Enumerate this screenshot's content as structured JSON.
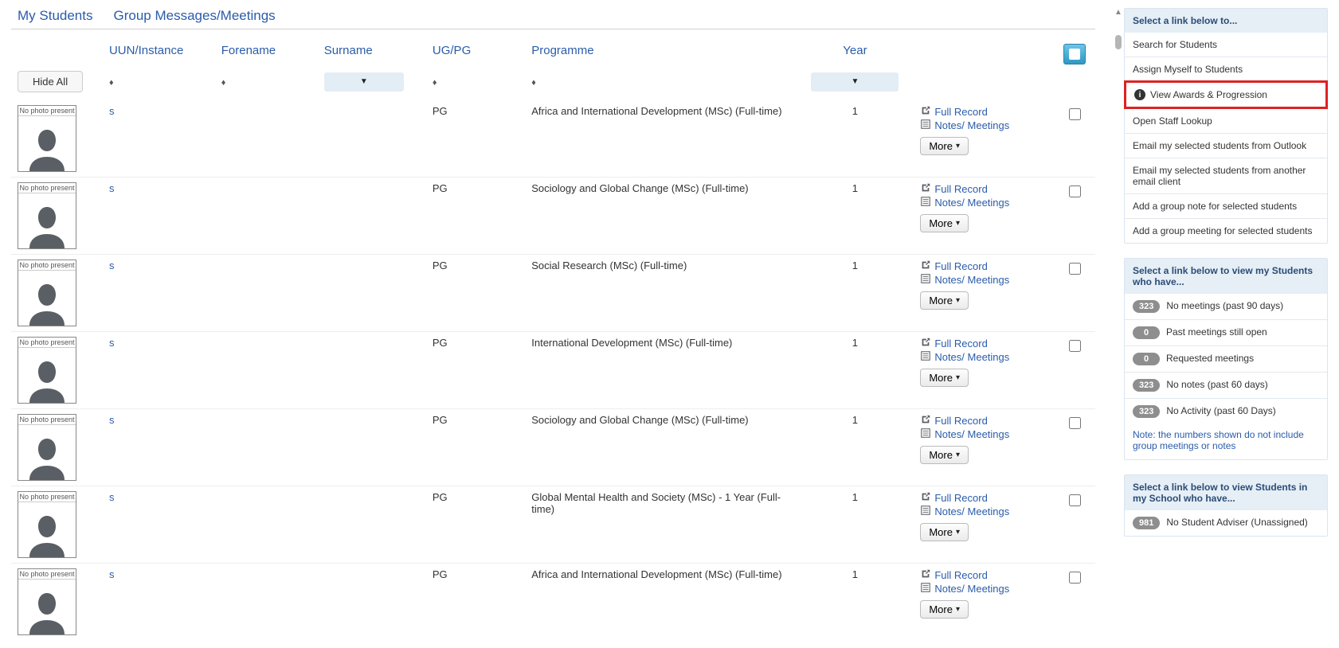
{
  "tabs": {
    "my_students": "My Students",
    "group_msgs": "Group Messages/Meetings"
  },
  "headers": {
    "uun": "UUN/Instance",
    "forename": "Forename",
    "surname": "Surname",
    "ugpg": "UG/PG",
    "programme": "Programme",
    "year": "Year"
  },
  "hide_all": "Hide All",
  "no_photo": "No photo present",
  "links": {
    "full_record": "Full Record",
    "notes": "Notes/ Meetings",
    "more": "More"
  },
  "rows": [
    {
      "uun": "s",
      "ugpg": "PG",
      "programme": "Africa and International Development (MSc) (Full-time)",
      "year": "1"
    },
    {
      "uun": "s",
      "ugpg": "PG",
      "programme": "Sociology and Global Change (MSc) (Full-time)",
      "year": "1"
    },
    {
      "uun": "s",
      "ugpg": "PG",
      "programme": "Social Research (MSc) (Full-time)",
      "year": "1"
    },
    {
      "uun": "s",
      "ugpg": "PG",
      "programme": "International Development (MSc) (Full-time)",
      "year": "1"
    },
    {
      "uun": "s",
      "ugpg": "PG",
      "programme": "Sociology and Global Change (MSc) (Full-time)",
      "year": "1"
    },
    {
      "uun": "s",
      "ugpg": "PG",
      "programme": "Global Mental Health and Society (MSc) - 1 Year (Full-time)",
      "year": "1"
    },
    {
      "uun": "s",
      "ugpg": "PG",
      "programme": "Africa and International Development (MSc) (Full-time)",
      "year": "1"
    }
  ],
  "side1": {
    "header": "Select a link below to...",
    "items": [
      "Search for Students",
      "Assign Myself to Students",
      "View Awards & Progression",
      "Open Staff Lookup",
      "Email my selected students from Outlook",
      "Email my selected students from another email client",
      "Add a group note for selected students",
      "Add a group meeting for selected students"
    ]
  },
  "side2": {
    "header": "Select a link below to view my Students who have...",
    "items": [
      {
        "badge": "323",
        "label": "No meetings (past 90 days)"
      },
      {
        "badge": "0",
        "label": "Past meetings still open"
      },
      {
        "badge": "0",
        "label": "Requested meetings"
      },
      {
        "badge": "323",
        "label": "No notes (past 60 days)"
      },
      {
        "badge": "323",
        "label": "No Activity (past 60 Days)"
      }
    ],
    "note": "Note: the numbers shown do not include group meetings or notes"
  },
  "side3": {
    "header": "Select a link below to view Students in my School who have...",
    "items": [
      {
        "badge": "981",
        "label": "No Student Adviser (Unassigned)"
      }
    ]
  }
}
